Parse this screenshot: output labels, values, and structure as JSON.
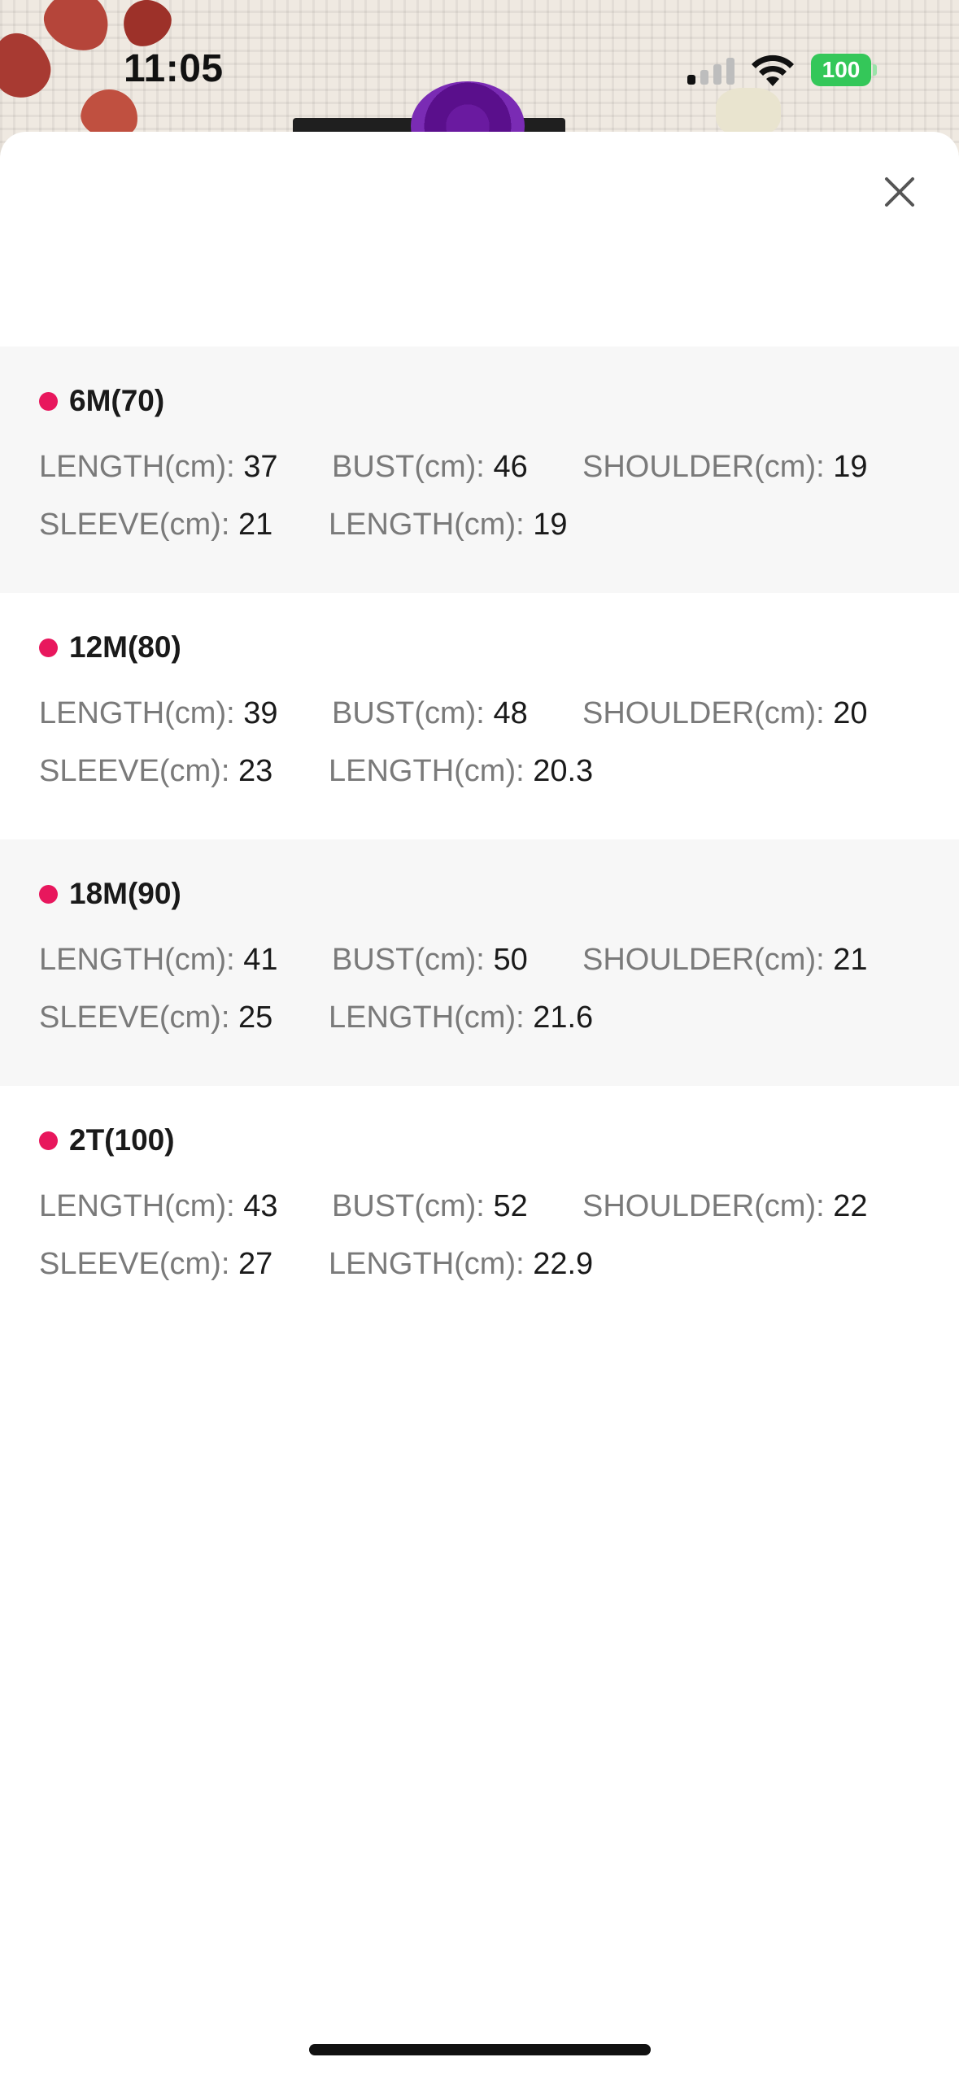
{
  "status_bar": {
    "time": "11:05",
    "battery_level": "100",
    "icons": [
      "cellular-signal-icon",
      "wifi-icon",
      "battery-icon"
    ]
  },
  "sheet": {
    "close_icon": "close-icon",
    "accent_color": "#e8175d",
    "sizes": [
      {
        "name": "6M(70)",
        "rows": [
          [
            {
              "label": "LENGTH(cm): ",
              "value": "37"
            },
            {
              "label": "BUST(cm): ",
              "value": "46"
            },
            {
              "label": "SHOULDER(cm): ",
              "value": "19"
            }
          ],
          [
            {
              "label": "SLEEVE(cm): ",
              "value": "21"
            },
            {
              "label": "LENGTH(cm): ",
              "value": "19"
            }
          ]
        ]
      },
      {
        "name": "12M(80)",
        "rows": [
          [
            {
              "label": "LENGTH(cm): ",
              "value": "39"
            },
            {
              "label": "BUST(cm): ",
              "value": "48"
            },
            {
              "label": "SHOULDER(cm): ",
              "value": "20"
            }
          ],
          [
            {
              "label": "SLEEVE(cm): ",
              "value": "23"
            },
            {
              "label": "LENGTH(cm): ",
              "value": "20.3"
            }
          ]
        ]
      },
      {
        "name": "18M(90)",
        "rows": [
          [
            {
              "label": "LENGTH(cm): ",
              "value": "41"
            },
            {
              "label": "BUST(cm): ",
              "value": "50"
            },
            {
              "label": "SHOULDER(cm): ",
              "value": "21"
            }
          ],
          [
            {
              "label": "SLEEVE(cm): ",
              "value": "25"
            },
            {
              "label": "LENGTH(cm): ",
              "value": "21.6"
            }
          ]
        ]
      },
      {
        "name": "2T(100)",
        "rows": [
          [
            {
              "label": "LENGTH(cm): ",
              "value": "43"
            },
            {
              "label": "BUST(cm): ",
              "value": "52"
            },
            {
              "label": "SHOULDER(cm): ",
              "value": "22"
            }
          ],
          [
            {
              "label": "SLEEVE(cm): ",
              "value": "27"
            },
            {
              "label": "LENGTH(cm): ",
              "value": "22.9"
            }
          ]
        ]
      }
    ]
  }
}
